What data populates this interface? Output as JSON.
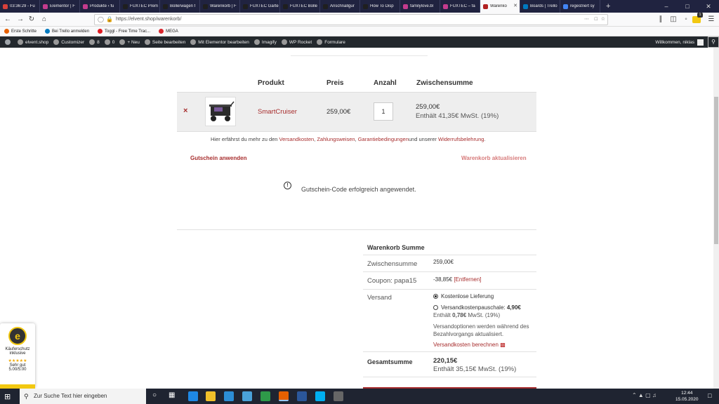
{
  "browser": {
    "tabs": [
      {
        "title": "03:36:29 - Fu",
        "color": "#d9403a",
        "active": false
      },
      {
        "title": "Elementor | F",
        "color": "#c43b8d",
        "active": false
      },
      {
        "title": "Produkte ‹ fu",
        "color": "#c43b8d",
        "active": false
      },
      {
        "title": "FUXTEC Prem",
        "color": "#1f1f1f",
        "active": false
      },
      {
        "title": "Bollerwagen f",
        "color": "#1f1f1f",
        "active": false
      },
      {
        "title": "Warenkorb | F",
        "color": "#1f1f1f",
        "active": false
      },
      {
        "title": "FUXTEC Garte",
        "color": "#1f1f1f",
        "active": false
      },
      {
        "title": "FUXTEC Bolle",
        "color": "#1f1f1f",
        "active": false
      },
      {
        "title": "Anschnallgur",
        "color": "#1f1f1f",
        "active": false
      },
      {
        "title": "How To Disp",
        "color": "#1f1f1f",
        "active": false
      },
      {
        "title": "familylove.bl",
        "color": "#c43b8d",
        "active": false
      },
      {
        "title": "FUXTEC – fa",
        "color": "#c43b8d",
        "active": false
      },
      {
        "title": "Warenko",
        "color": "#b22222",
        "active": true
      },
      {
        "title": "Boards | Trello",
        "color": "#0079bf",
        "active": false
      },
      {
        "title": "regestriert sy",
        "color": "#4285f4",
        "active": false
      }
    ],
    "new_tab": "+",
    "url": "https://elvent.shop/warenkorb/",
    "bookmarks": [
      {
        "label": "Erste Schritte",
        "color": "#e66000"
      },
      {
        "label": "Bei Trello anmelden",
        "color": "#0079bf"
      },
      {
        "label": "Toggl - Free Time Trac...",
        "color": "#e01b22"
      },
      {
        "label": "MEGA",
        "color": "#d9272e"
      }
    ],
    "badge": "1"
  },
  "wpbar": {
    "items": [
      {
        "label": "elvent.shop"
      },
      {
        "label": "Customizer"
      },
      {
        "label": "8"
      },
      {
        "label": "0"
      },
      {
        "label": "+ Neu"
      },
      {
        "label": "Seite bearbeiten"
      },
      {
        "label": "Mit Elementor bearbeiten"
      },
      {
        "label": "Imagify"
      },
      {
        "label": "WP Rocket"
      },
      {
        "label": "Formulare"
      }
    ],
    "greeting": "Willkommen, niklas"
  },
  "cart": {
    "headers": {
      "product": "Produkt",
      "price": "Preis",
      "qty": "Anzahl",
      "subtotal": "Zwischensumme"
    },
    "row": {
      "remove": "×",
      "name": "SmartCruiser",
      "price": "259,00€",
      "qty": "1",
      "subtotal": "259,00€",
      "tax": "Enthält 41,35€ MwSt. (19%)"
    },
    "info": {
      "prefix": "Hier erfährst du mehr zu den ",
      "link1": "Versandkosten",
      "sep1": ", ",
      "link2": "Zahlungsweisen",
      "sep2": ", ",
      "link3": "Garantiebedingungen",
      "mid": "und unserer ",
      "link4": "Widerrufsbelehrung",
      "end": "."
    },
    "coupon_button": "Gutschein anwenden",
    "update_button": "Warenkorb aktualisieren",
    "notice": "Gutschein-Code erfolgreich angewendet."
  },
  "totals": {
    "title": "Warenkorb Summe",
    "subtotal_label": "Zwischensumme",
    "subtotal_value": "259,00€",
    "coupon_label": "Coupon: papa15",
    "coupon_value": "-38,85€",
    "coupon_remove": "[Entfernen]",
    "shipping_label": "Versand",
    "shipping_option1": "Kostenlose Lieferung",
    "shipping_option2_prefix": "Versandkostenpauschale: ",
    "shipping_option2_price": "4,90€",
    "shipping_option2_tax_prefix": "Enthält ",
    "shipping_option2_tax_value": "0,78€",
    "shipping_option2_tax_suffix": " MwSt. (19%)",
    "shipping_note": "Versandoptionen werden während des Bezahlvorgangs aktualisiert.",
    "shipping_calc": "Versandkosten berechnen",
    "total_label": "Gesamtsumme",
    "total_value": "220,15€",
    "total_tax": "Enthält 35,15€ MwSt. (19%)"
  },
  "trusted": {
    "line1": "Käuferschutz",
    "line2": "inklusive",
    "stars": "★★★★★",
    "rating_label": "Sehr gut",
    "rating": "5.00/5.00",
    "logo_letter": "e"
  },
  "taskbar": {
    "search_placeholder": "Zur Suche Text hier eingeben",
    "time": "12:44",
    "date": "15.05.2020"
  }
}
